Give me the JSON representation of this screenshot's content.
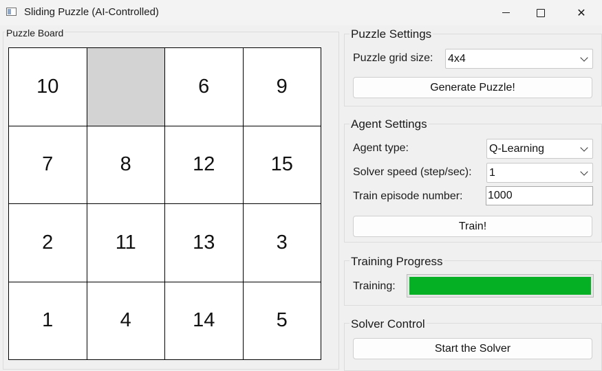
{
  "window": {
    "title": "Sliding Puzzle (AI-Controlled)"
  },
  "board": {
    "title": "Puzzle Board",
    "tiles": [
      "10",
      "",
      "6",
      "9",
      "7",
      "8",
      "12",
      "15",
      "2",
      "11",
      "13",
      "3",
      "1",
      "4",
      "14",
      "5"
    ]
  },
  "puzzle_settings": {
    "title": "Puzzle Settings",
    "grid_size_label": "Puzzle grid size:",
    "grid_size_value": "4x4",
    "generate_label": "Generate Puzzle!"
  },
  "agent_settings": {
    "title": "Agent Settings",
    "agent_type_label": "Agent type:",
    "agent_type_value": "Q-Learning",
    "speed_label": "Solver speed (step/sec):",
    "speed_value": "1",
    "episodes_label": "Train episode number:",
    "episodes_value": "1000",
    "train_label": "Train!"
  },
  "training_progress": {
    "title": "Training Progress",
    "label": "Training:",
    "value": 1.0,
    "color": "#06b025"
  },
  "solver_control": {
    "title": "Solver Control",
    "start_label": "Start the Solver"
  },
  "icons": {
    "app": "app-window-icon",
    "minimize": "minimize-icon",
    "maximize": "maximize-icon",
    "close": "close-icon",
    "dropdown": "chevron-down-icon"
  }
}
